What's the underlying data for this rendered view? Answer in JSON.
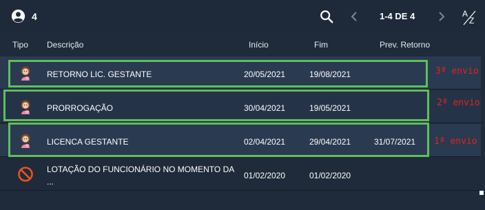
{
  "toolbar": {
    "record_count": "4",
    "pagination": "1-4 DE 4",
    "user_icon": "account-circle-icon",
    "search_icon": "search-icon",
    "prev_icon": "chevron-left-icon",
    "next_icon": "chevron-right-icon",
    "sort_icon": "sort-az-icon"
  },
  "columns": {
    "tipo": "Tipo",
    "descricao": "Descrição",
    "inicio": "Início",
    "fim": "Fim",
    "prev_retorno": "Prev. Retorno"
  },
  "rows": [
    {
      "icon": "pregnant-woman-icon",
      "descricao": "RETORNO LIC. GESTANTE",
      "inicio": "20/05/2021",
      "fim": "19/08/2021",
      "prev_retorno": ""
    },
    {
      "icon": "pregnant-woman-icon",
      "descricao": "PRORROGAÇÃO",
      "inicio": "30/04/2021",
      "fim": "19/05/2021",
      "prev_retorno": ""
    },
    {
      "icon": "pregnant-woman-icon",
      "descricao": "LICENCA GESTANTE",
      "inicio": "02/04/2021",
      "fim": "29/04/2021",
      "prev_retorno": "31/07/2021"
    },
    {
      "icon": "blocked-icon",
      "descricao": "LOTAÇÃO DO FUNCIONÁRIO NO MOMENTO DA ...",
      "inicio": "01/02/2020",
      "fim": "01/02/2020",
      "prev_retorno": ""
    }
  ],
  "annotations": [
    "3ª envio",
    "2ª envio",
    "1ª envio"
  ],
  "colors": {
    "highlight": "#5fbf5a",
    "annotation": "#e0241b",
    "row_bg": "#2a3a51"
  }
}
